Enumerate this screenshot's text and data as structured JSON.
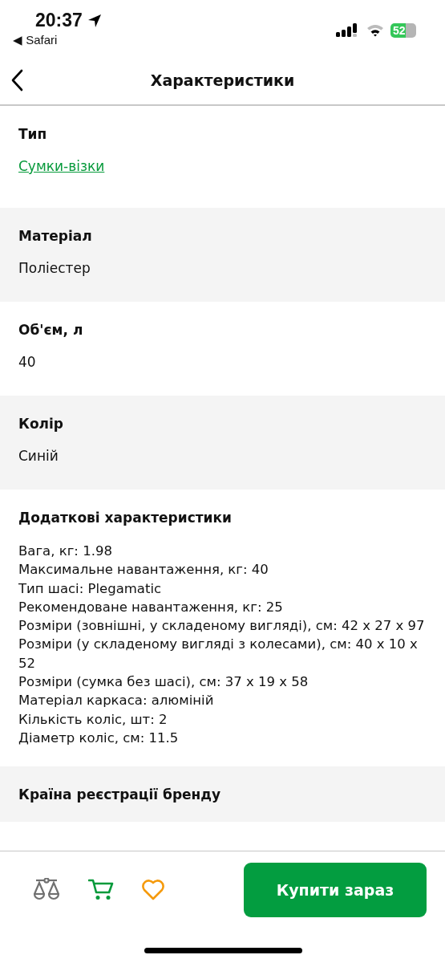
{
  "status_bar": {
    "time": "20:37",
    "back_app": "◀ Safari",
    "battery": "52"
  },
  "header": {
    "title": "Характеристики"
  },
  "sections": [
    {
      "title": "Тип",
      "kind": "link",
      "value": "Сумки-візки"
    },
    {
      "title": "Матеріал",
      "kind": "text",
      "value": "Поліестер"
    },
    {
      "title": "Об'єм, л",
      "kind": "text",
      "value": "40"
    },
    {
      "title": "Колір",
      "kind": "text",
      "value": "Синій"
    },
    {
      "title": "Додаткові характеристики",
      "kind": "list",
      "lines": [
        "Вага, кг: 1.98",
        "Максимальне навантаження, кг: 40",
        "Тип шасі: Plegamatic",
        "Рекомендоване навантаження, кг: 25",
        "Розміри (зовнішні, у складеному вигляді), см: 42 х 27 х 97",
        "Розміри (у складеному вигляді з колесами), см: 40 х 10 х 52",
        "Розміри (сумка без шасі), см: 37 х 19 х 58",
        "Матеріал каркаса: алюміній",
        "Кількість коліс, шт: 2",
        "Діаметр коліс, см: 11.5"
      ]
    },
    {
      "title": "Країна реєстрації бренду",
      "kind": "text"
    }
  ],
  "bottom_bar": {
    "buy_button": "Купити зараз"
  }
}
